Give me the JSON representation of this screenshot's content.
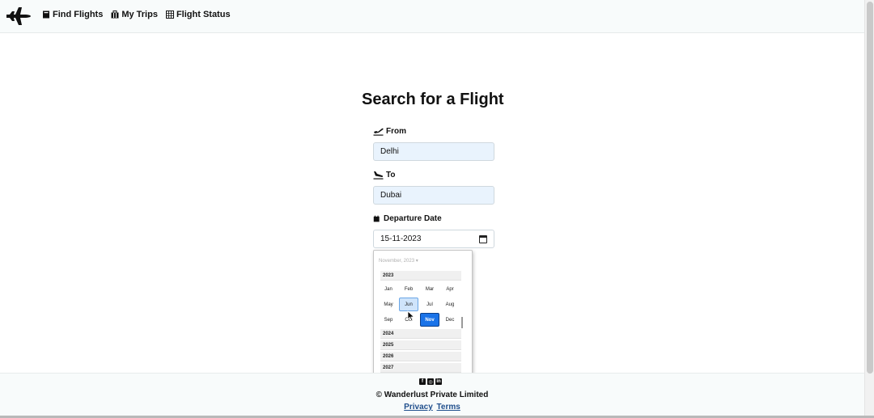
{
  "nav": {
    "links": [
      {
        "label": "Find Flights",
        "icon": "book-icon"
      },
      {
        "label": "My Trips",
        "icon": "suitcase-icon"
      },
      {
        "label": "Flight Status",
        "icon": "calendar-grid-icon"
      }
    ]
  },
  "form": {
    "title": "Search for a Flight",
    "from": {
      "label": "From",
      "value": "Delhi"
    },
    "to": {
      "label": "To",
      "value": "Dubai"
    },
    "date": {
      "label": "Departure Date",
      "value": "15-11-2023"
    }
  },
  "picker": {
    "header": "November, 2023 ▾",
    "current_year": "2023",
    "months": [
      "Jan",
      "Feb",
      "Mar",
      "Apr",
      "May",
      "Jun",
      "Jul",
      "Aug",
      "Sep",
      "Oct",
      "Nov",
      "Dec"
    ],
    "selected_month": "Nov",
    "hovered_month": "Jun",
    "next_years": [
      "2024",
      "2025",
      "2026",
      "2027"
    ]
  },
  "footer": {
    "social": [
      "facebook-icon",
      "instagram-icon",
      "linkedin-icon"
    ],
    "copyright": "© Wanderlust Private Limited",
    "links": [
      "Privacy",
      "Terms"
    ]
  },
  "colors": {
    "accent": "#1a73e8",
    "input_fill": "#e9f3fd",
    "link": "#1f4e8c"
  }
}
